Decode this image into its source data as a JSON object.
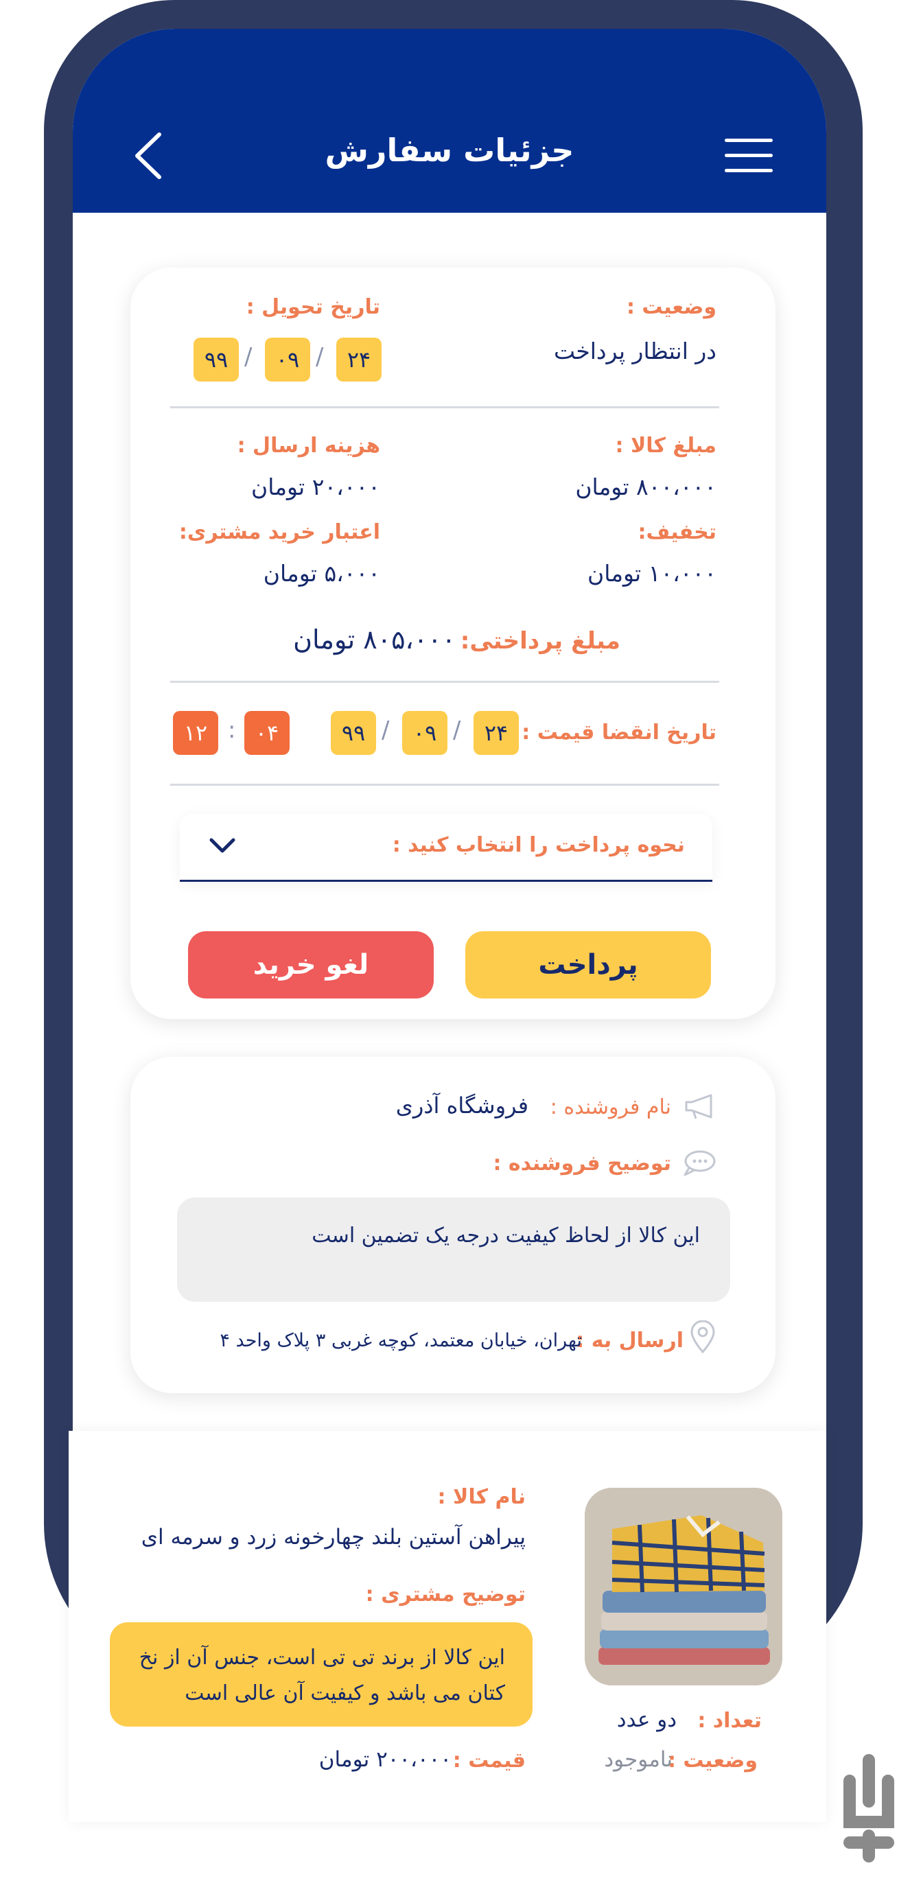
{
  "header": {
    "title": "جزئیات سفارش"
  },
  "summary": {
    "status_label": "وضعیت :",
    "status_value": "در انتظار پرداخت",
    "delivery_label": "تاریخ تحویل :",
    "delivery_date": {
      "day": "۲۴",
      "month": "۰۹",
      "year": "۹۹"
    },
    "goods_amount_label": "مبلغ کالا :",
    "goods_amount_value": "۸۰۰،۰۰۰ تومان",
    "shipping_label": "هزینه ارسال :",
    "shipping_value": "۲۰،۰۰۰ تومان",
    "discount_label": "تخفیف:",
    "discount_value": "۱۰،۰۰۰ تومان",
    "credit_label": "اعتبار خرید مشتری:",
    "credit_value": "۵،۰۰۰ تومان",
    "payable_label": "مبلغ پرداختی:",
    "payable_value": "۸۰۵،۰۰۰ تومان",
    "expiry_label": "تاریخ انقضا قیمت :",
    "expiry_date": {
      "day": "۲۴",
      "month": "۰۹",
      "year": "۹۹"
    },
    "expiry_time": {
      "hour": "۱۲",
      "minute": "۰۴"
    },
    "payment_method_placeholder": "نحوه پرداخت را انتخاب کنید :",
    "pay_button": "پرداخت",
    "cancel_button": "لغو خرید"
  },
  "seller": {
    "name_label": "نام فروشنده :",
    "name_value": "فروشگاه آذری",
    "description_label": "توضیح فروشنده :",
    "description_value": "این کالا از لحاظ کیفیت درجه یک تضمین است",
    "ship_to_label": "ارسال به :",
    "ship_to_value": "تهران، خیابان معتمد، کوچه غربی ۳ پلاک واحد ۴"
  },
  "product": {
    "name_label": "نام کالا :",
    "name_value": "پیراهن آستین بلند چهارخونه زرد و سرمه ای",
    "customer_note_label": "توضیح مشتری :",
    "customer_note_value": "این کالا از برند تی تی است، جنس آن از نخ کتان می باشد و کیفیت آن عالی است",
    "price_label": "قیمت :",
    "price_value": "۲۰۰،۰۰۰ تومان",
    "quantity_label": "تعداد :",
    "quantity_value": "دو عدد",
    "stock_label": "وضعیت :",
    "stock_value": "ناموجود"
  },
  "colors": {
    "primary": "#042f8f",
    "accent": "#ee7d52",
    "yellow": "#fecc4c",
    "red": "#ef5a5a",
    "text": "#16296b"
  }
}
